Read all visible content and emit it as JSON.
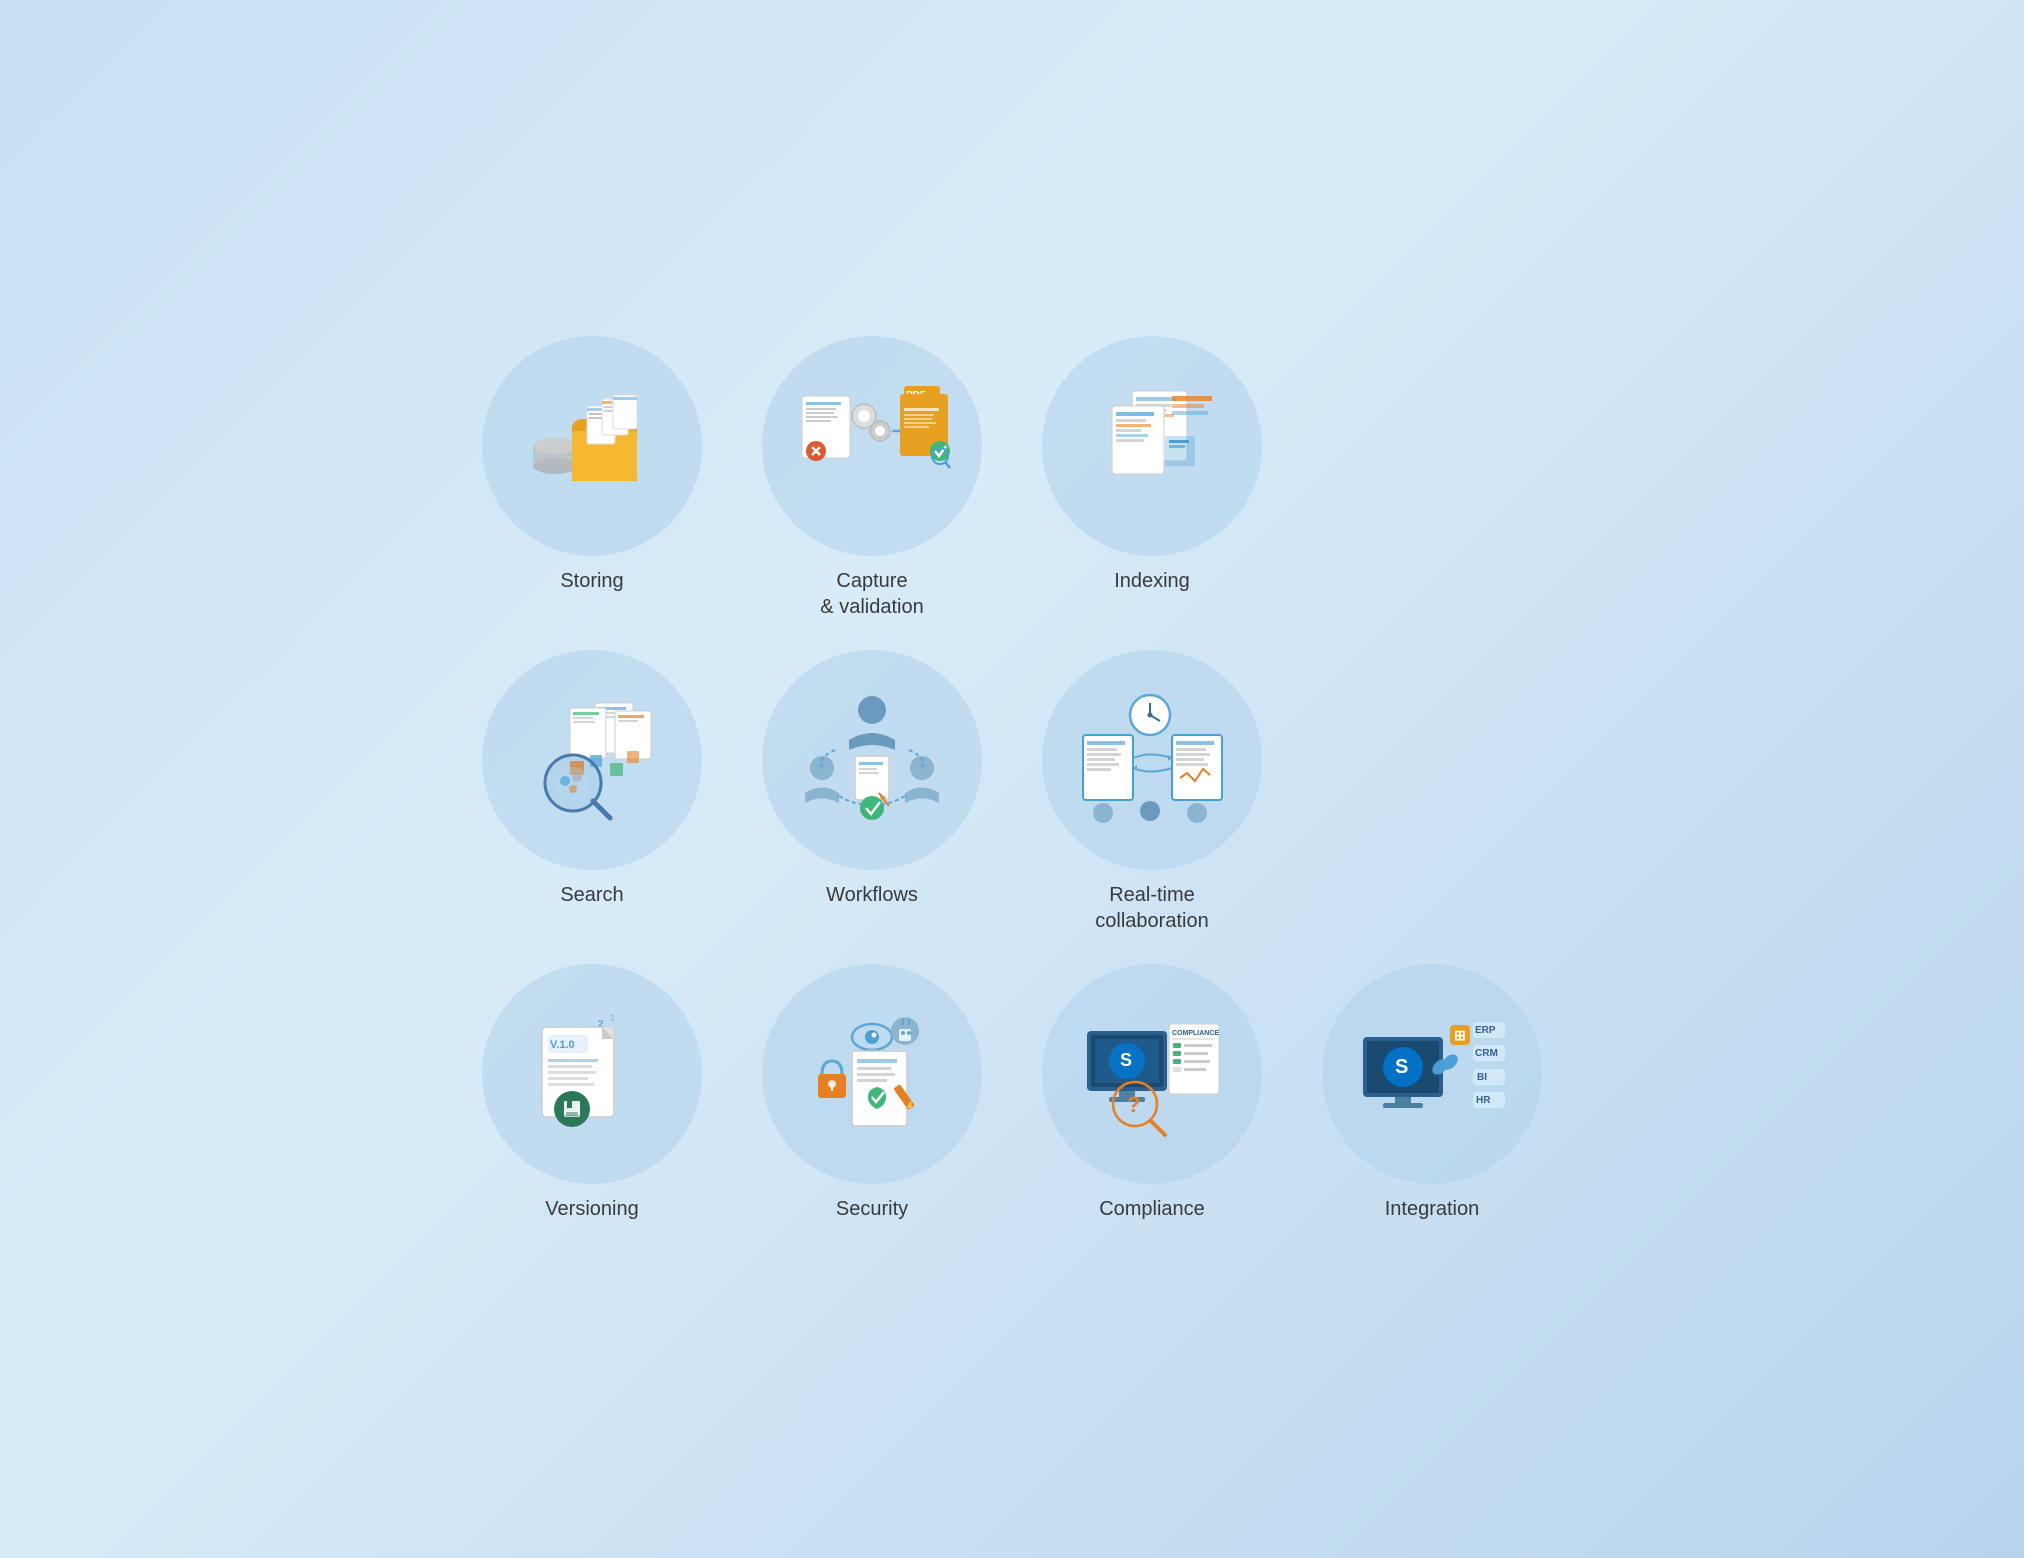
{
  "cards": [
    {
      "id": "storing",
      "label": "Storing",
      "row": 1,
      "col": 1
    },
    {
      "id": "capture",
      "label": "Capture\n& validation",
      "row": 1,
      "col": 2
    },
    {
      "id": "indexing",
      "label": "Indexing",
      "row": 1,
      "col": 3
    },
    {
      "id": "search",
      "label": "Search",
      "row": 2,
      "col": 1
    },
    {
      "id": "workflows",
      "label": "Workflows",
      "row": 2,
      "col": 2
    },
    {
      "id": "collaboration",
      "label": "Real-time\ncollaboration",
      "row": 2,
      "col": 3
    },
    {
      "id": "versioning",
      "label": "Versioning",
      "row": 3,
      "col": 1
    },
    {
      "id": "security",
      "label": "Security",
      "row": 3,
      "col": 2
    },
    {
      "id": "compliance",
      "label": "Compliance",
      "row": 3,
      "col": 3
    },
    {
      "id": "integration",
      "label": "Integration",
      "row": 3,
      "col": 4
    }
  ],
  "colors": {
    "circle_bg": "rgba(176, 210, 235, 0.55)",
    "label_color": "#3a3a3a"
  }
}
